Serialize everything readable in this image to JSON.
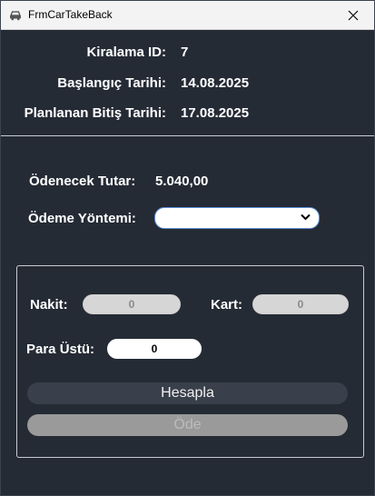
{
  "window": {
    "title": "FrmCarTakeBack"
  },
  "info": {
    "rental_id_label": "Kiralama ID:",
    "rental_id_value": "7",
    "start_date_label": "Başlangıç Tarihi:",
    "start_date_value": "14.08.2025",
    "planned_end_label": "Planlanan Bitiş Tarihi:",
    "planned_end_value": "17.08.2025"
  },
  "payment": {
    "amount_label": "Ödenecek Tutar:",
    "amount_value": "5.040,00",
    "method_label": "Ödeme Yöntemi:",
    "method_selected": ""
  },
  "breakdown": {
    "cash_label": "Nakit:",
    "cash_value": "0",
    "card_label": "Kart:",
    "card_value": "0",
    "change_label": "Para Üstü:",
    "change_value": "0"
  },
  "buttons": {
    "calculate_label": "Hesapla",
    "pay_label": "Öde"
  }
}
